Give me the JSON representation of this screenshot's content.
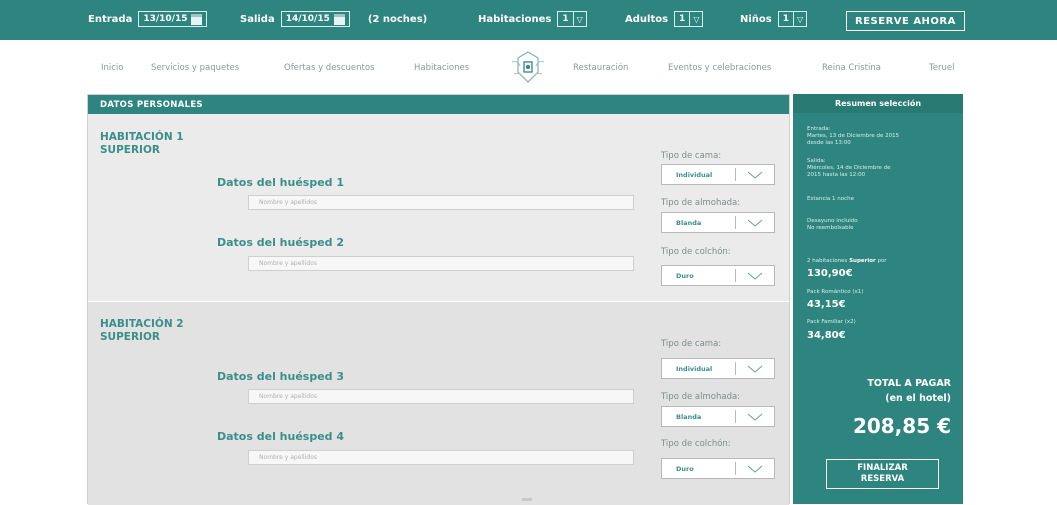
{
  "booking_bar": {
    "checkin_label": "Entrada",
    "checkin_value": "13/10/15",
    "checkout_label": "Salida",
    "checkout_value": "14/10/15",
    "nights": "(2 noches)",
    "rooms_label": "Habitaciones",
    "rooms_value": "1",
    "adults_label": "Adultos",
    "adults_value": "1",
    "children_label": "Niños",
    "children_value": "1",
    "reserve_button": "RESERVE AHORA"
  },
  "nav": {
    "items": [
      "Inicio",
      "Servicios y paquetes",
      "Ofertas y descuentos",
      "Habitaciones",
      "Restauración",
      "Eventos y celebraciones",
      "Reina Cristina",
      "Teruel"
    ]
  },
  "form": {
    "header": "DATOS PERSONALES",
    "rooms": [
      {
        "title_line1": "HABITACIÓN 1",
        "title_line2": "SUPERIOR",
        "guests": [
          {
            "label": "Datos del huésped 1",
            "placeholder": "Nombre y apellidos"
          },
          {
            "label": "Datos del huésped 2",
            "placeholder": "Nombre y apellidos"
          }
        ],
        "options": [
          {
            "label": "Tipo de cama:",
            "value": "Individual"
          },
          {
            "label": "Tipo de almohada:",
            "value": "Blanda"
          },
          {
            "label": "Tipo de colchón:",
            "value": "Duro"
          }
        ]
      },
      {
        "title_line1": "HABITACIÓN 2",
        "title_line2": "SUPERIOR",
        "guests": [
          {
            "label": "Datos del huésped 3",
            "placeholder": "Nombre y apellidos"
          },
          {
            "label": "Datos del huésped 4",
            "placeholder": "Nombre y apellidos"
          }
        ],
        "options": [
          {
            "label": "Tipo de cama:",
            "value": "Individual"
          },
          {
            "label": "Tipo de almohada:",
            "value": "Blanda"
          },
          {
            "label": "Tipo de colchón:",
            "value": "Duro"
          }
        ]
      }
    ]
  },
  "summary": {
    "header": "Resumen selección",
    "entry_label": "Entrada:",
    "entry_line1": "Martes, 13 de Diciembre de 2015",
    "entry_line2": "desde las 13:00",
    "exit_label": "Salida:",
    "exit_line1": "Miércoles, 14 de Diciembre de",
    "exit_line2": "2015 hasta las 12:00",
    "stay": "Estancia 1 noche",
    "breakfast_line1": "Desayuno incluido",
    "breakfast_line2": "No reembolsable",
    "rooms_line_prefix": "2 habitaciones",
    "rooms_line_bold": "Superior",
    "rooms_line_suffix": "por",
    "rooms_price": "130,90€",
    "pack1_label": "Pack Romántico (x1)",
    "pack1_price": "43,15€",
    "pack2_label": "Pack Familiar (x2)",
    "pack2_price": "34,80€",
    "total_label_line1": "TOTAL A PAGAR",
    "total_label_line2": "(en el hotel)",
    "total_value": "208,85 €",
    "finish_line1": "FINALIZAR",
    "finish_line2": "RESERVA"
  },
  "colors": {
    "brand": "#2e857f",
    "accent_text": "#3b8f89"
  },
  "icons": [
    "calendar-icon",
    "chevron-down-icon",
    "hotel-logo-icon"
  ]
}
